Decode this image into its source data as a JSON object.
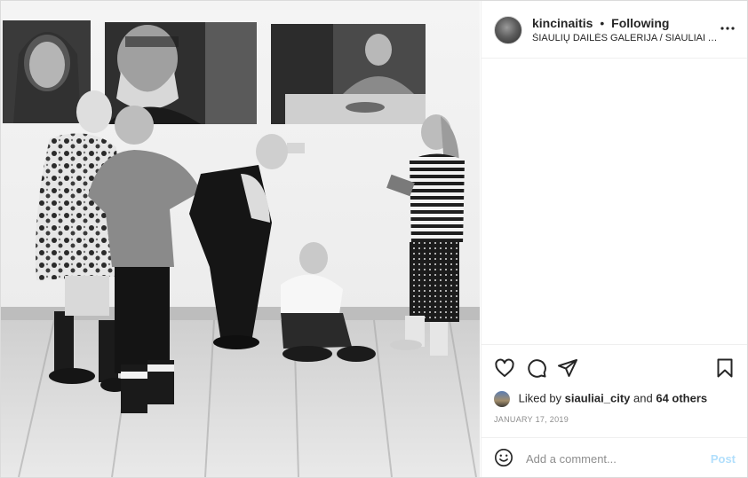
{
  "post": {
    "photo_alt": "Children looking at photographs in a gallery",
    "header": {
      "username": "kincinaitis",
      "separator": "•",
      "follow_status": "Following",
      "location": "ŠIAULIŲ DAILĖS GALERIJA / SIAULIAI A..."
    },
    "likes": {
      "prefix": "Liked by",
      "liker": "siauliai_city",
      "conjunction": "and",
      "others": "64 others"
    },
    "date": "JANUARY 17, 2019",
    "comment": {
      "placeholder": "Add a comment...",
      "post_label": "Post"
    }
  },
  "icons": {
    "more": "more-options-icon",
    "like": "heart-icon",
    "comment": "comment-icon",
    "share": "paper-plane-icon",
    "save": "bookmark-icon",
    "emoji": "emoji-icon"
  },
  "colors": {
    "border": "#dbdbdb",
    "text": "#262626",
    "muted": "#8e8e8e",
    "post_disabled": "#b2dffc"
  }
}
